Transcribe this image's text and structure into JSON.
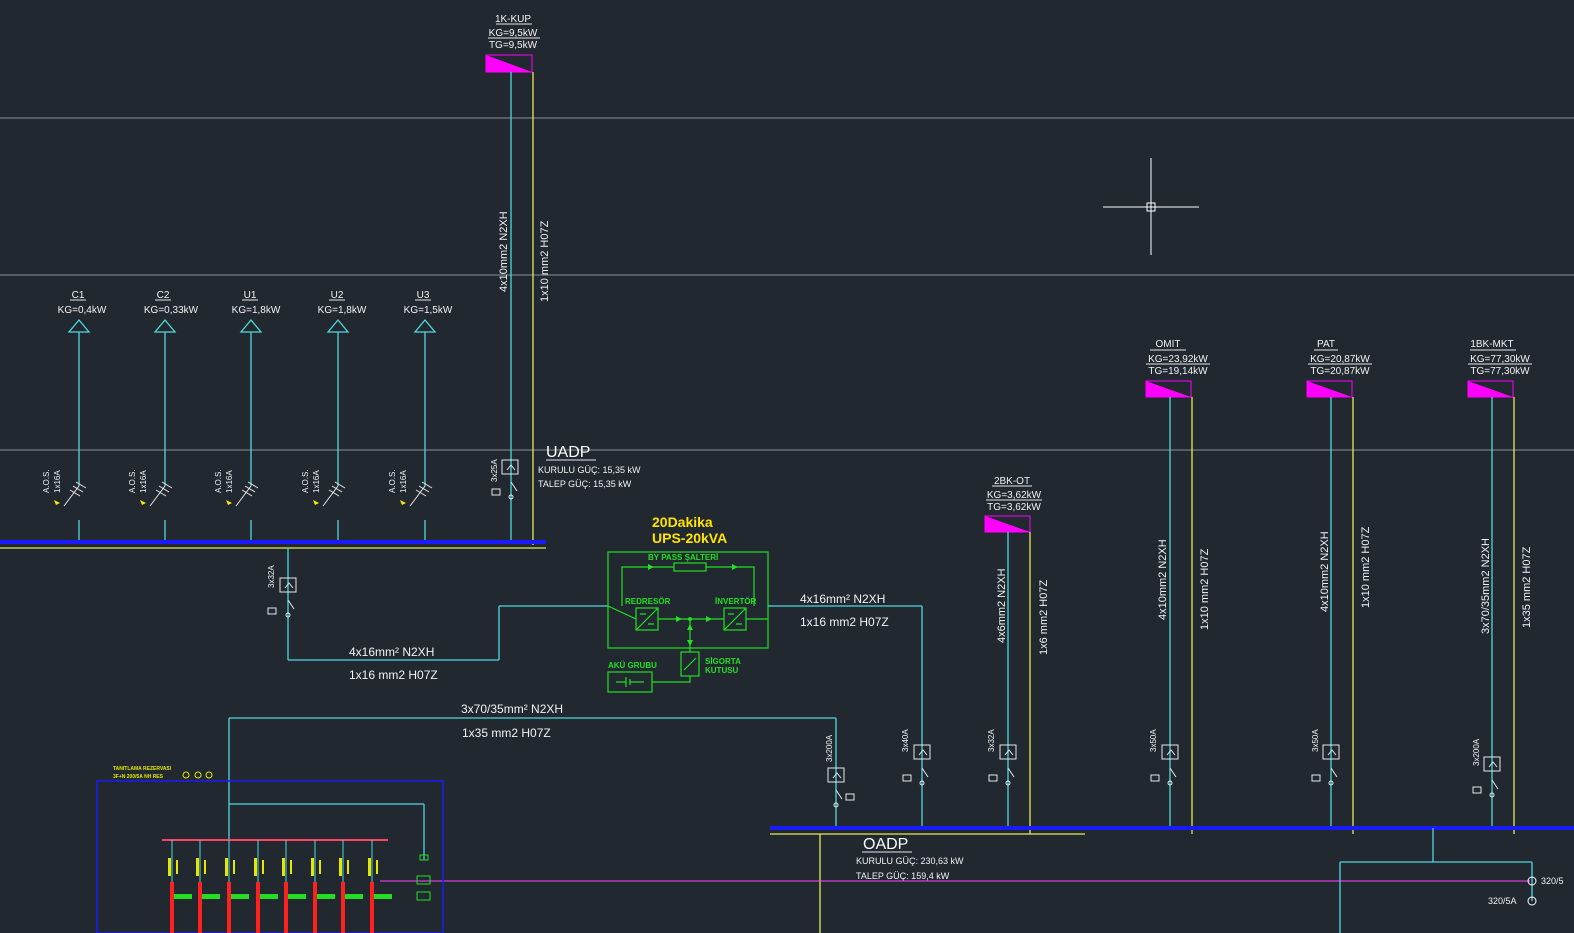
{
  "feeders_top": [
    {
      "name": "C1",
      "kg": "KG=0,4kW",
      "breaker_type": "A.O.S.",
      "breaker_rating": "1x16A"
    },
    {
      "name": "C2",
      "kg": "KG=0,33kW",
      "breaker_type": "A.O.S.",
      "breaker_rating": "1x16A"
    },
    {
      "name": "U1",
      "kg": "KG=1,8kW",
      "breaker_type": "A.O.S.",
      "breaker_rating": "1x16A"
    },
    {
      "name": "U2",
      "kg": "KG=1,8kW",
      "breaker_type": "A.O.S.",
      "breaker_rating": "1x16A"
    },
    {
      "name": "U3",
      "kg": "KG=1,5kW",
      "breaker_type": "A.O.S.",
      "breaker_rating": "1x16A"
    }
  ],
  "panel_1k": {
    "name": "1K-KUP",
    "kg": "KG=9,5kW",
    "tg": "TG=9,5kW",
    "cable1": "4x10mm2 N2XH",
    "cable2": "1x10 mm2 H07Z",
    "breaker": "3x25A"
  },
  "uadp": {
    "title": "UADP",
    "installed": "KURULU GÜÇ: 15,35 kW",
    "demand": "TALEP GÜÇ:    15,35 kW"
  },
  "uadp_out": {
    "breaker": "3x32A",
    "cable1": "4x16mm² N2XH",
    "cable2": "1x16 mm2 H07Z"
  },
  "ups": {
    "title1": "20Dakika",
    "title2": "UPS-20kVA",
    "bypass": "BY PASS ŞALTERİ",
    "rectifier": "REDRESÖR",
    "inverter": "İNVERTÖR",
    "battery": "AKÜ GRUBU",
    "fuse1": "SİGORTA",
    "fuse2": "KUTUSU",
    "out_cable1": "4x16mm² N2XH",
    "out_cable2": "1x16 mm2 H07Z",
    "out_breaker": "3x40A"
  },
  "main_feed": {
    "cable1": "3x70/35mm² N2XH",
    "cable2": "1x35 mm2 H07Z",
    "breaker": "3x200A"
  },
  "panel_2bk": {
    "name": "2BK-OT",
    "kg": "KG=3,62kW",
    "tg": "TG=3,62kW",
    "cable1": "4x6mm2 N2XH",
    "cable2": "1x6 mm2 H07Z",
    "breaker": "3x32A"
  },
  "panel_omit": {
    "name": "OMIT",
    "kg": "KG=23,92kW",
    "tg": "TG=19,14kW",
    "cable1": "4x10mm2 N2XH",
    "cable2": "1x10 mm2 H07Z",
    "breaker": "3x50A"
  },
  "panel_pat": {
    "name": "PAT",
    "kg": "KG=20,87kW",
    "tg": "TG=20,87kW",
    "cable1": "4x10mm2 N2XH",
    "cable2": "1x10 mm2 H07Z",
    "breaker": "3x50A"
  },
  "panel_1bk": {
    "name": "1BK-MKT",
    "kg": "KG=77,30kW",
    "tg": "TG=77,30kW",
    "cable1": "3x70/35mm2 N2XH",
    "cable2": "1x35 mm2 H07Z",
    "breaker": "3x200A"
  },
  "oadp": {
    "title": "OADP",
    "installed": "KURULU GÜÇ: 230,63 kW",
    "demand": "TALEP GÜÇ:    159,4 kW"
  },
  "ct_labels": [
    "320/5",
    "320/5A"
  ],
  "lower_panel": {
    "label1": "TANITLAMA REZERVASI",
    "label2": "3F+N 200/5A NH RES"
  },
  "colors": {
    "background": "#212830",
    "cable": "#4fd8dc",
    "ground": "#e8e85a",
    "bus": "#1a1aff",
    "panel": "#ff00ff",
    "ups": "#22e022",
    "ups_title": "#ffe400"
  }
}
